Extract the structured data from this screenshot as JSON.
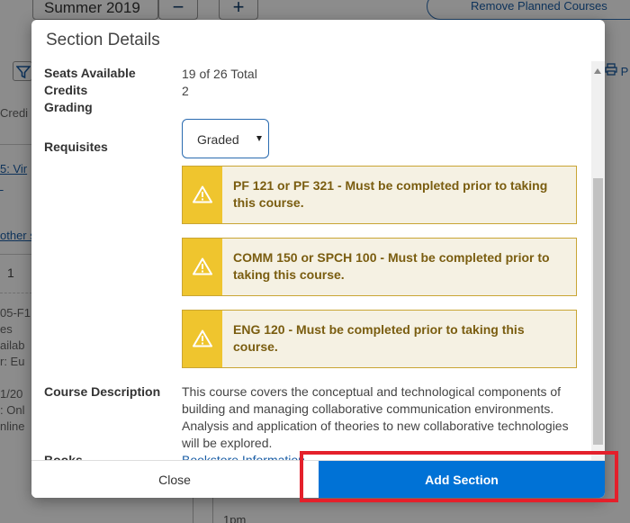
{
  "background": {
    "term": "Summer 2019",
    "minus": "−",
    "plus": "+",
    "remove_planned": "Remove Planned Courses",
    "left_fragments": [
      "Credi",
      "5: Vir",
      " ",
      "other s",
      "05-F1",
      "es",
      "ailab",
      "r: Eu",
      "1/20",
      ": Onl",
      "nline"
    ],
    "cell_value": "1",
    "print_fragment": "P",
    "time_label": "1pm"
  },
  "dialog": {
    "title": "Section Details",
    "labels": {
      "seats": "Seats Available",
      "credits": "Credits",
      "grading": "Grading",
      "requisites": "Requisites",
      "description": "Course Description",
      "books": "Books"
    },
    "seats_value": "19 of 26 Total",
    "credits_value": "2",
    "grading_selected": "Graded",
    "requisites": [
      "PF 121 or PF 321 - Must be completed prior to taking this course.",
      "COMM 150 or SPCH 100 - Must be completed prior to taking this course.",
      "ENG 120 - Must be completed prior to taking this course."
    ],
    "description": "This course covers the conceptual and technological components of building and managing collaborative communication environments. Analysis and application of theories to new collaborative technologies will be explored.",
    "books_link": "Bookstore Information",
    "footer": {
      "close_label": "Close",
      "add_label": "Add Section"
    }
  },
  "colors": {
    "primary_button": "#0072d6",
    "warning_icon_bg": "#efc52e",
    "warning_bg": "#f5f1e3",
    "warning_text": "#7a5d10",
    "highlight": "#e4202b"
  },
  "icons": {
    "filter": "filter-icon",
    "warning": "warning-triangle-icon",
    "dropdown": "chevron-down-icon",
    "print": "print-icon"
  }
}
